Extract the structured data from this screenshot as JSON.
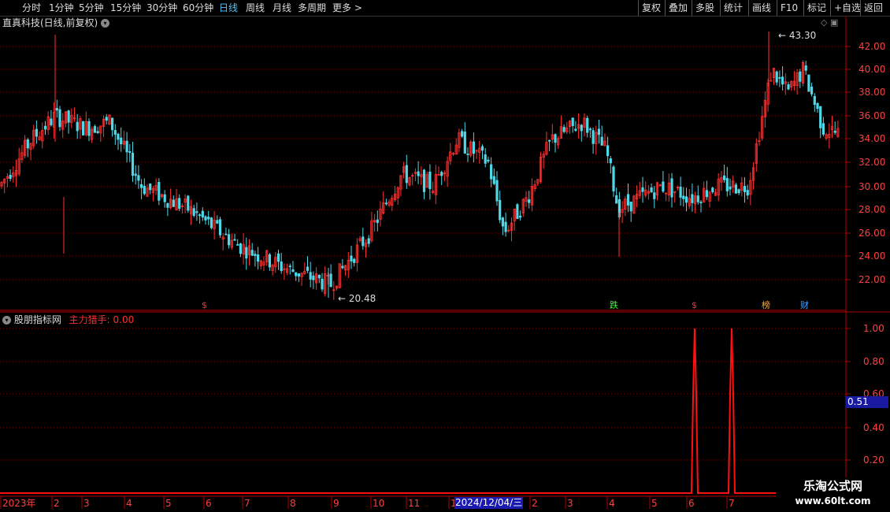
{
  "toolbar": {
    "periods": [
      "分时",
      "1分钟",
      "5分钟",
      "15分钟",
      "30分钟",
      "60分钟",
      "日线",
      "周线",
      "月线",
      "多周期",
      "更多 >"
    ],
    "active": "日线",
    "right_buttons": [
      "复权",
      "叠加",
      "多股",
      "统计",
      "画线",
      "F10",
      "标记",
      "+自选",
      "返回"
    ]
  },
  "main_panel": {
    "title": "直真科技(日线,前复权)",
    "y_ticks": [
      "42.00",
      "40.00",
      "38.00",
      "36.00",
      "34.00",
      "32.00",
      "30.00",
      "28.00",
      "26.00",
      "24.00",
      "22.00"
    ],
    "high_label": "43.30",
    "low_label": "20.48",
    "markers": [
      {
        "text": "$",
        "color": "#ff3030"
      },
      {
        "text": "跌",
        "color": "#30ff30"
      },
      {
        "text": "$",
        "color": "#ff3030"
      },
      {
        "text": "榜",
        "color": "#ffaa30"
      },
      {
        "text": "财",
        "color": "#40a0ff"
      }
    ]
  },
  "sub_panel": {
    "title": "股朋指标网",
    "indicator": "主力猎手: 0.00",
    "y_ticks": [
      "1.00",
      "0.80",
      "0.60",
      "0.40",
      "0.20"
    ],
    "cursor_value": "0.51",
    "indicator_data": {
      "type": "line",
      "spikes": [
        {
          "month": "6",
          "value": 1.0
        },
        {
          "month": "7",
          "value": 1.0
        }
      ],
      "baseline": 0.0
    }
  },
  "x_axis": {
    "labels": [
      "2023年",
      "2",
      "3",
      "4",
      "5",
      "6",
      "7",
      "8",
      "9",
      "10",
      "11",
      "1",
      "2",
      "3",
      "4",
      "5",
      "6",
      "7"
    ],
    "cursor_date": "2024/12/04/三"
  },
  "watermark": {
    "line1": "乐淘公式网",
    "line2": "www.60lt.com"
  },
  "colors": {
    "up": "#ff3030",
    "down": "#4fd8e8",
    "grid": "#7a0000",
    "axis": "#b00000",
    "signal": "#ff1010"
  }
}
